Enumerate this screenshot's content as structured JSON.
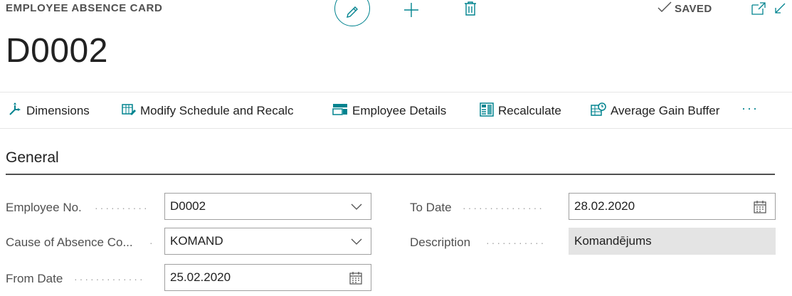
{
  "header": {
    "caption": "EMPLOYEE ABSENCE CARD",
    "saved_label": "SAVED",
    "title": "D0002",
    "icons": [
      "pencil-icon",
      "plus-icon",
      "trash-icon",
      "checkmark-icon",
      "open-new-window-icon",
      "collapse-icon"
    ]
  },
  "actions": [
    {
      "label": "Dimensions",
      "icon": "dimensions-icon"
    },
    {
      "label": "Modify Schedule and Recalc",
      "icon": "modify-schedule-icon"
    },
    {
      "label": "Employee Details",
      "icon": "employee-details-icon"
    },
    {
      "label": "Recalculate",
      "icon": "calculator-icon"
    },
    {
      "label": "Average Gain Buffer",
      "icon": "buffer-icon"
    }
  ],
  "more_label": "···",
  "general": {
    "title": "General",
    "employee_no": {
      "label": "Employee No.",
      "value": "D0002"
    },
    "cause": {
      "label": "Cause of Absence Co...",
      "value": "KOMAND"
    },
    "from_date": {
      "label": "From Date",
      "value": "25.02.2020"
    },
    "to_date": {
      "label": "To Date",
      "value": "28.02.2020"
    },
    "description": {
      "label": "Description",
      "value": "Komandējums"
    }
  },
  "colors": {
    "accent": "#00838f",
    "border": "#a0a0a0",
    "readonly_bg": "#e4e4e4"
  }
}
